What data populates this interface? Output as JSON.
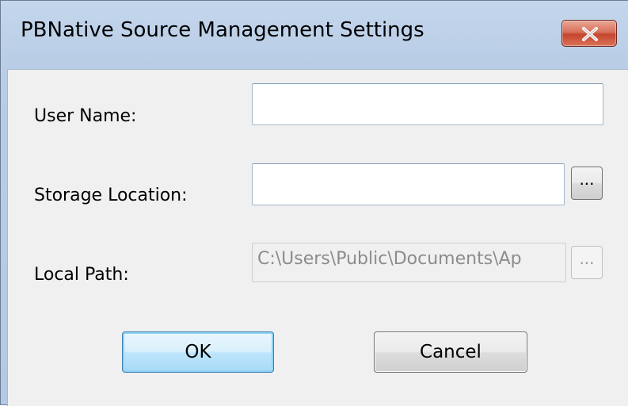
{
  "window": {
    "title": "PBNative Source Management Settings",
    "close_icon": "close-x-icon"
  },
  "form": {
    "user_name": {
      "label": "User Name:",
      "value": ""
    },
    "storage_location": {
      "label": "Storage Location:",
      "value": "",
      "browse_label": "..."
    },
    "local_path": {
      "label": "Local Path:",
      "value": "C:\\Users\\Public\\Documents\\Ap",
      "browse_label": "...",
      "enabled": false
    }
  },
  "buttons": {
    "ok_label": "OK",
    "cancel_label": "Cancel"
  },
  "colors": {
    "titlebar": "#b9cde6",
    "close_button": "#c5452d",
    "client_background": "#f0f0f0",
    "default_button": "#bee6fd"
  }
}
